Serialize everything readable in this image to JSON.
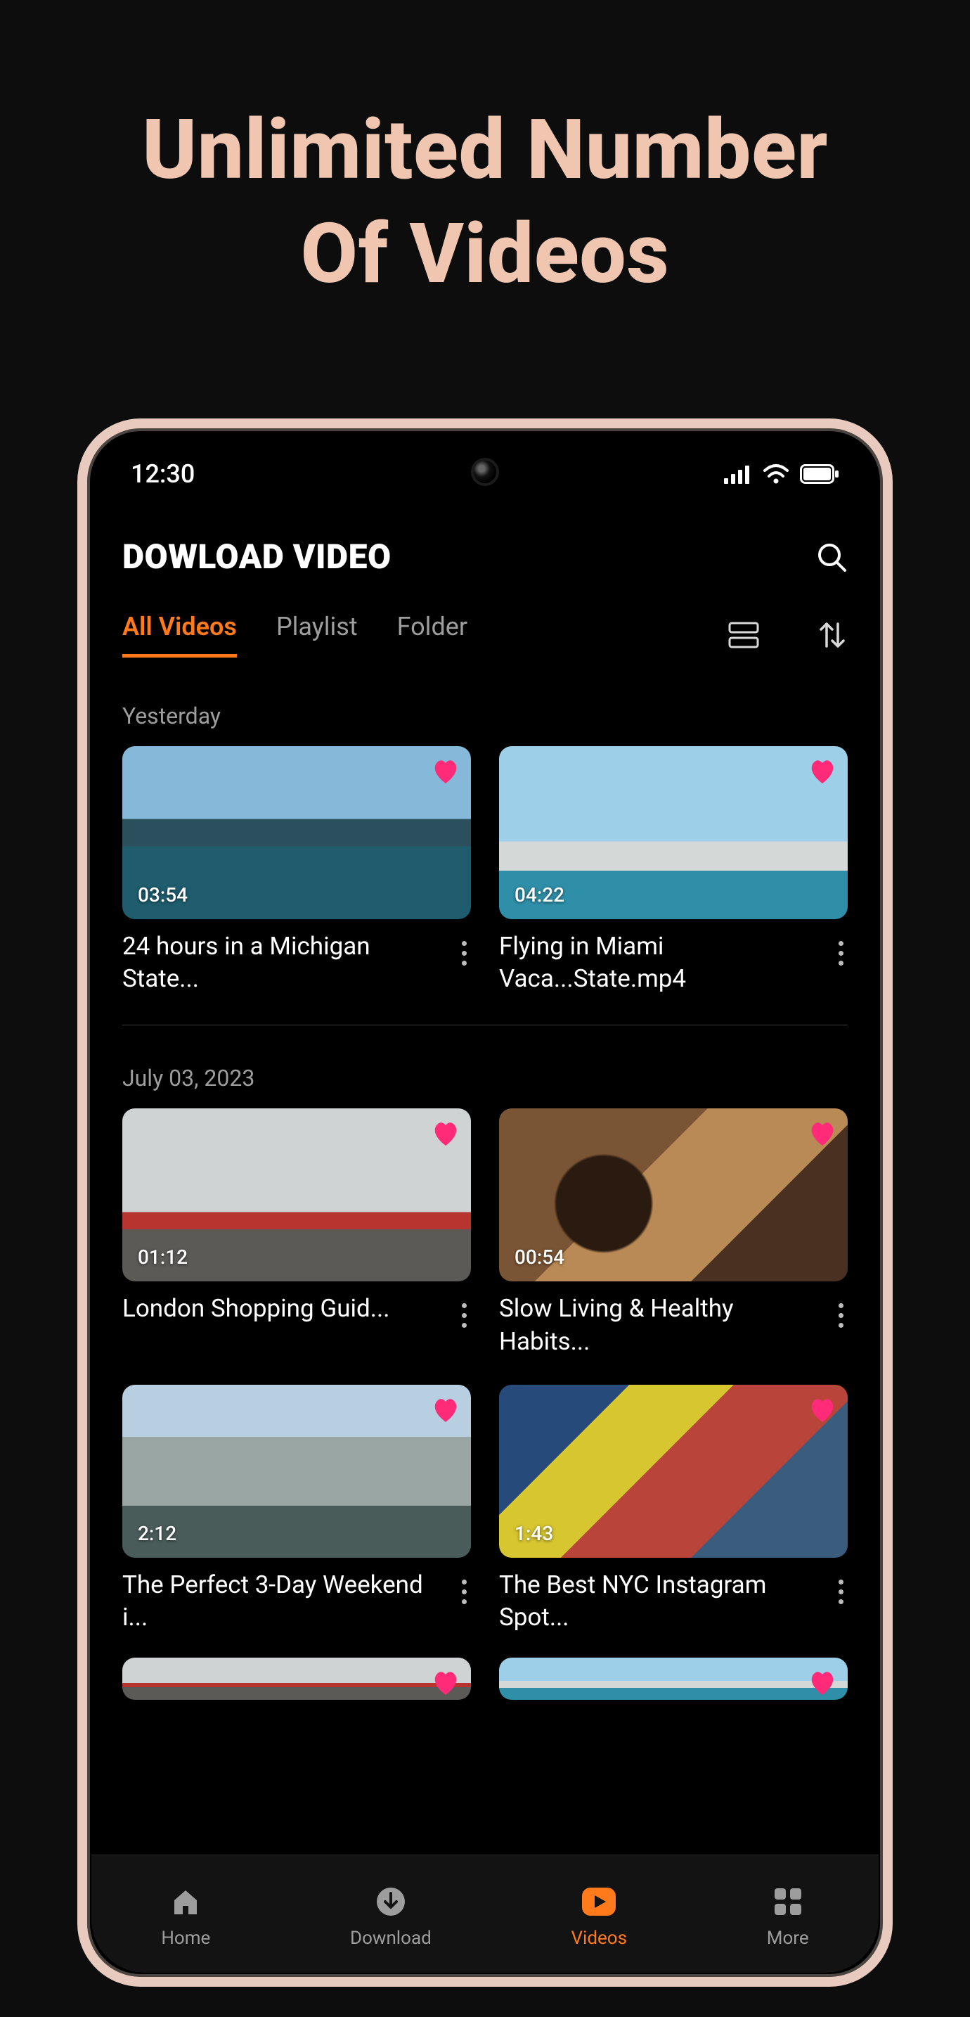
{
  "hero": {
    "line1": "Unlimited Number",
    "line2": "Of Videos"
  },
  "statusbar": {
    "time": "12:30"
  },
  "header": {
    "title": "DOWLOAD VIDEO"
  },
  "tabs": {
    "all": "All Videos",
    "playlist": "Playlist",
    "folder": "Folder"
  },
  "sections": [
    {
      "title": "Yesterday",
      "items": [
        {
          "duration": "03:54",
          "title": "24 hours in a Michigan State..."
        },
        {
          "duration": "04:22",
          "title": "Flying in Miami Vaca...State.mp4"
        }
      ]
    },
    {
      "title": "July 03, 2023",
      "items": [
        {
          "duration": "01:12",
          "title": "London Shopping Guid..."
        },
        {
          "duration": "00:54",
          "title": "Slow Living & Healthy Habits..."
        },
        {
          "duration": "2:12",
          "title": "The Perfect 3-Day Weekend i..."
        },
        {
          "duration": "1:43",
          "title": "The Best NYC Instagram Spot..."
        }
      ]
    }
  ],
  "nav": {
    "home": "Home",
    "download": "Download",
    "videos": "Videos",
    "more": "More"
  }
}
